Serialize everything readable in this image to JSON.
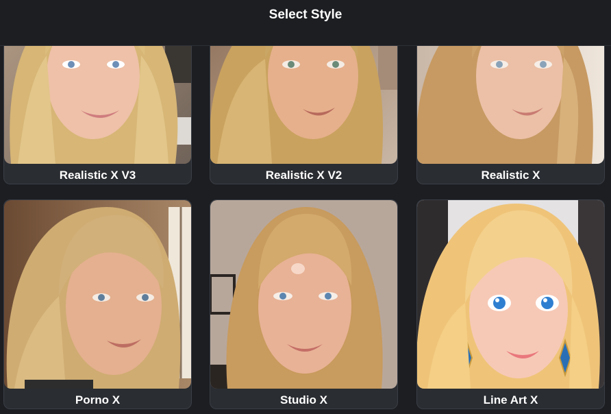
{
  "header": {
    "title": "Select Style"
  },
  "styles": [
    {
      "label": "Realistic X V3",
      "image": "portrait-blonde-realistic"
    },
    {
      "label": "Realistic X V2",
      "image": "portrait-blonde-warm"
    },
    {
      "label": "Realistic X",
      "image": "portrait-blonde-soft"
    },
    {
      "label": "Porno X",
      "image": "portrait-blonde-window"
    },
    {
      "label": "Studio X",
      "image": "portrait-blonde-studio"
    },
    {
      "label": "Line Art X",
      "image": "portrait-blonde-anime"
    }
  ],
  "colors": {
    "background": "#1c1e22",
    "card": "#2a2d32",
    "card_border": "#3b3f46",
    "text": "#ffffff"
  }
}
